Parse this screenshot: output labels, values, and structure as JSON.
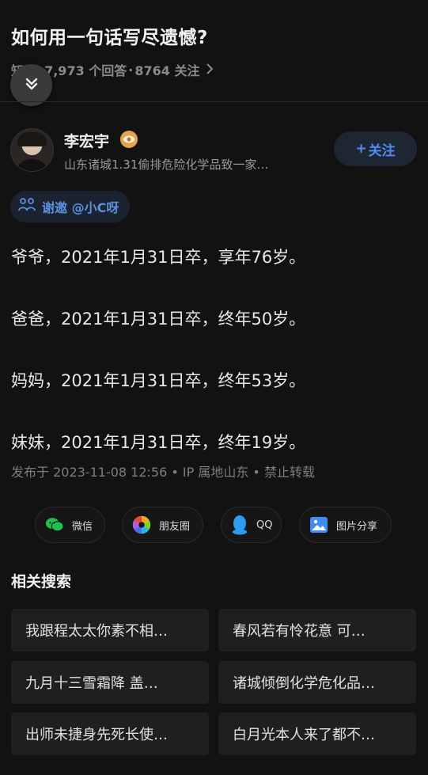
{
  "question": {
    "title": "如何用一句话写尽遗憾?",
    "meta_source": "知乎",
    "meta_answers": "7,973 个回答",
    "meta_followers": "8764 关注",
    "meta_separator": "·"
  },
  "author": {
    "name": "李宏宇",
    "bio": "山东诸城1.31偷排危险化学品致一家…",
    "follow_label": "关注",
    "follow_plus": "+",
    "badge_color": "#e7a24a"
  },
  "invite": {
    "label": "谢邀 @小C呀"
  },
  "answer": {
    "lines": [
      "爷爷，2021年1月31日卒，享年76岁。",
      "爸爸，2021年1月31日卒，终年50岁。",
      "妈妈，2021年1月31日卒，终年53岁。",
      "妹妹，2021年1月31日卒，终年19岁。"
    ],
    "publish_info": "发布于 2023-11-08 12:56 • IP 属地山东 • 禁止转载"
  },
  "share": {
    "wechat": "微信",
    "moments": "朋友圈",
    "qq": "QQ",
    "image_share": "图片分享"
  },
  "related": {
    "title": "相关搜索",
    "items": [
      "我跟程太太你素不相…",
      "春风若有怜花意 可…",
      "九月十三雪霜降 盖…",
      "诸城倾倒化学危化品…",
      "出师未捷身先死长使…",
      "白月光本人来了都不…"
    ]
  },
  "colors": {
    "background": "#121212",
    "accent_blue": "#4d8cf5",
    "card": "#1f1f1f"
  }
}
